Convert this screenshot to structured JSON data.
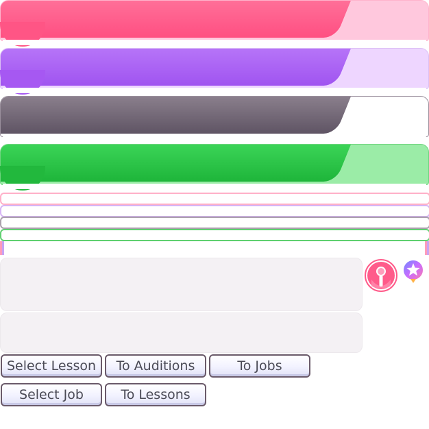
{
  "palette": {
    "pink": "#ff5e8c",
    "pink_light": "#ffc8dd",
    "purple": "#a95ff5",
    "purple_light": "#eed6ff",
    "gray": "#6b5f6e",
    "green": "#26c141",
    "green_light": "#9beca7"
  },
  "banners": [
    {
      "name": "pink-banner",
      "color": "pink"
    },
    {
      "name": "purple-banner",
      "color": "purple"
    },
    {
      "name": "gray-banner",
      "color": "gray"
    },
    {
      "name": "green-banner",
      "color": "green"
    }
  ],
  "icons": {
    "microphone": "microphone-icon",
    "star": "star-badge-icon"
  },
  "buttons": {
    "select_lesson": "Select Lesson",
    "to_auditions": "To Auditions",
    "to_jobs": "To Jobs",
    "select_job": "Select Job",
    "to_lessons": "To Lessons"
  }
}
